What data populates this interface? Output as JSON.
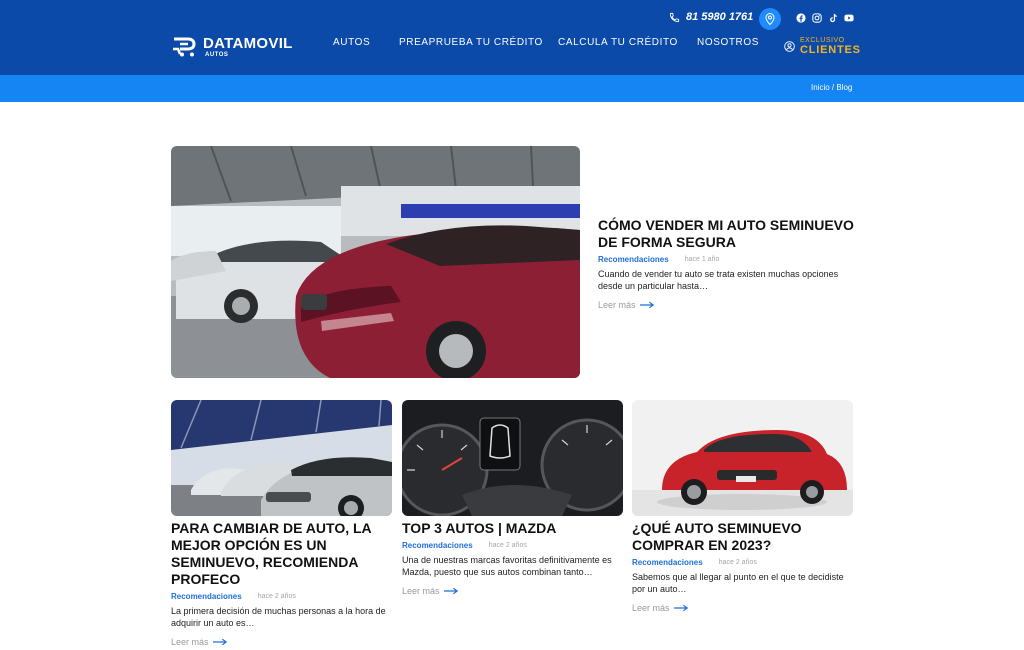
{
  "header": {
    "phone": "81 5980 1761",
    "logo_name": "DATAMOVIL",
    "logo_sub": "AUTOS",
    "nav": [
      "AUTOS",
      "PREAPRUEBA TU CRÉDITO",
      "CALCULA TU CRÉDITO",
      "NOSOTROS"
    ],
    "clientes_small": "EXCLUSIVO",
    "clientes_big": "CLIENTES",
    "socials": [
      "facebook-icon",
      "instagram-icon",
      "tiktok-icon",
      "youtube-icon"
    ]
  },
  "breadcrumb": "Inicio / Blog",
  "featured": {
    "title": "CÓMO VENDER MI AUTO SEMINUEVO DE FORMA SEGURA",
    "category": "Recomendaciones",
    "age": "hace 1 año",
    "excerpt": "Cuando de vender tu auto se trata existen muchas opciones desde un particular hasta…",
    "readmore": "Leer más"
  },
  "cards": [
    {
      "title": "PARA CAMBIAR DE AUTO, LA MEJOR OPCIÓN ES UN SEMINUEVO, RECOMIENDA PROFECO",
      "category": "Recomendaciones",
      "age": "hace 2 años",
      "excerpt": "La primera decisión de muchas personas a la hora de adquirir un auto es…",
      "readmore": "Leer más"
    },
    {
      "title": "TOP 3 AUTOS | MAZDA",
      "category": "Recomendaciones",
      "age": "hace 2 años",
      "excerpt": "Una de nuestras marcas favoritas definitivamente es Mazda, puesto que sus autos combinan tanto…",
      "readmore": "Leer más"
    },
    {
      "title": "¿QUÉ AUTO SEMINUEVO COMPRAR EN 2023?",
      "category": "Recomendaciones",
      "age": "hace 2 años",
      "excerpt": "Sabemos que al llegar al punto en el que te decidiste por un auto…",
      "readmore": "Leer más"
    }
  ],
  "colors": {
    "header": "#0b4aa8",
    "breadcrumb_bar": "#1485f3",
    "accent": "#f5b51d",
    "category": "#1f6fd8"
  }
}
